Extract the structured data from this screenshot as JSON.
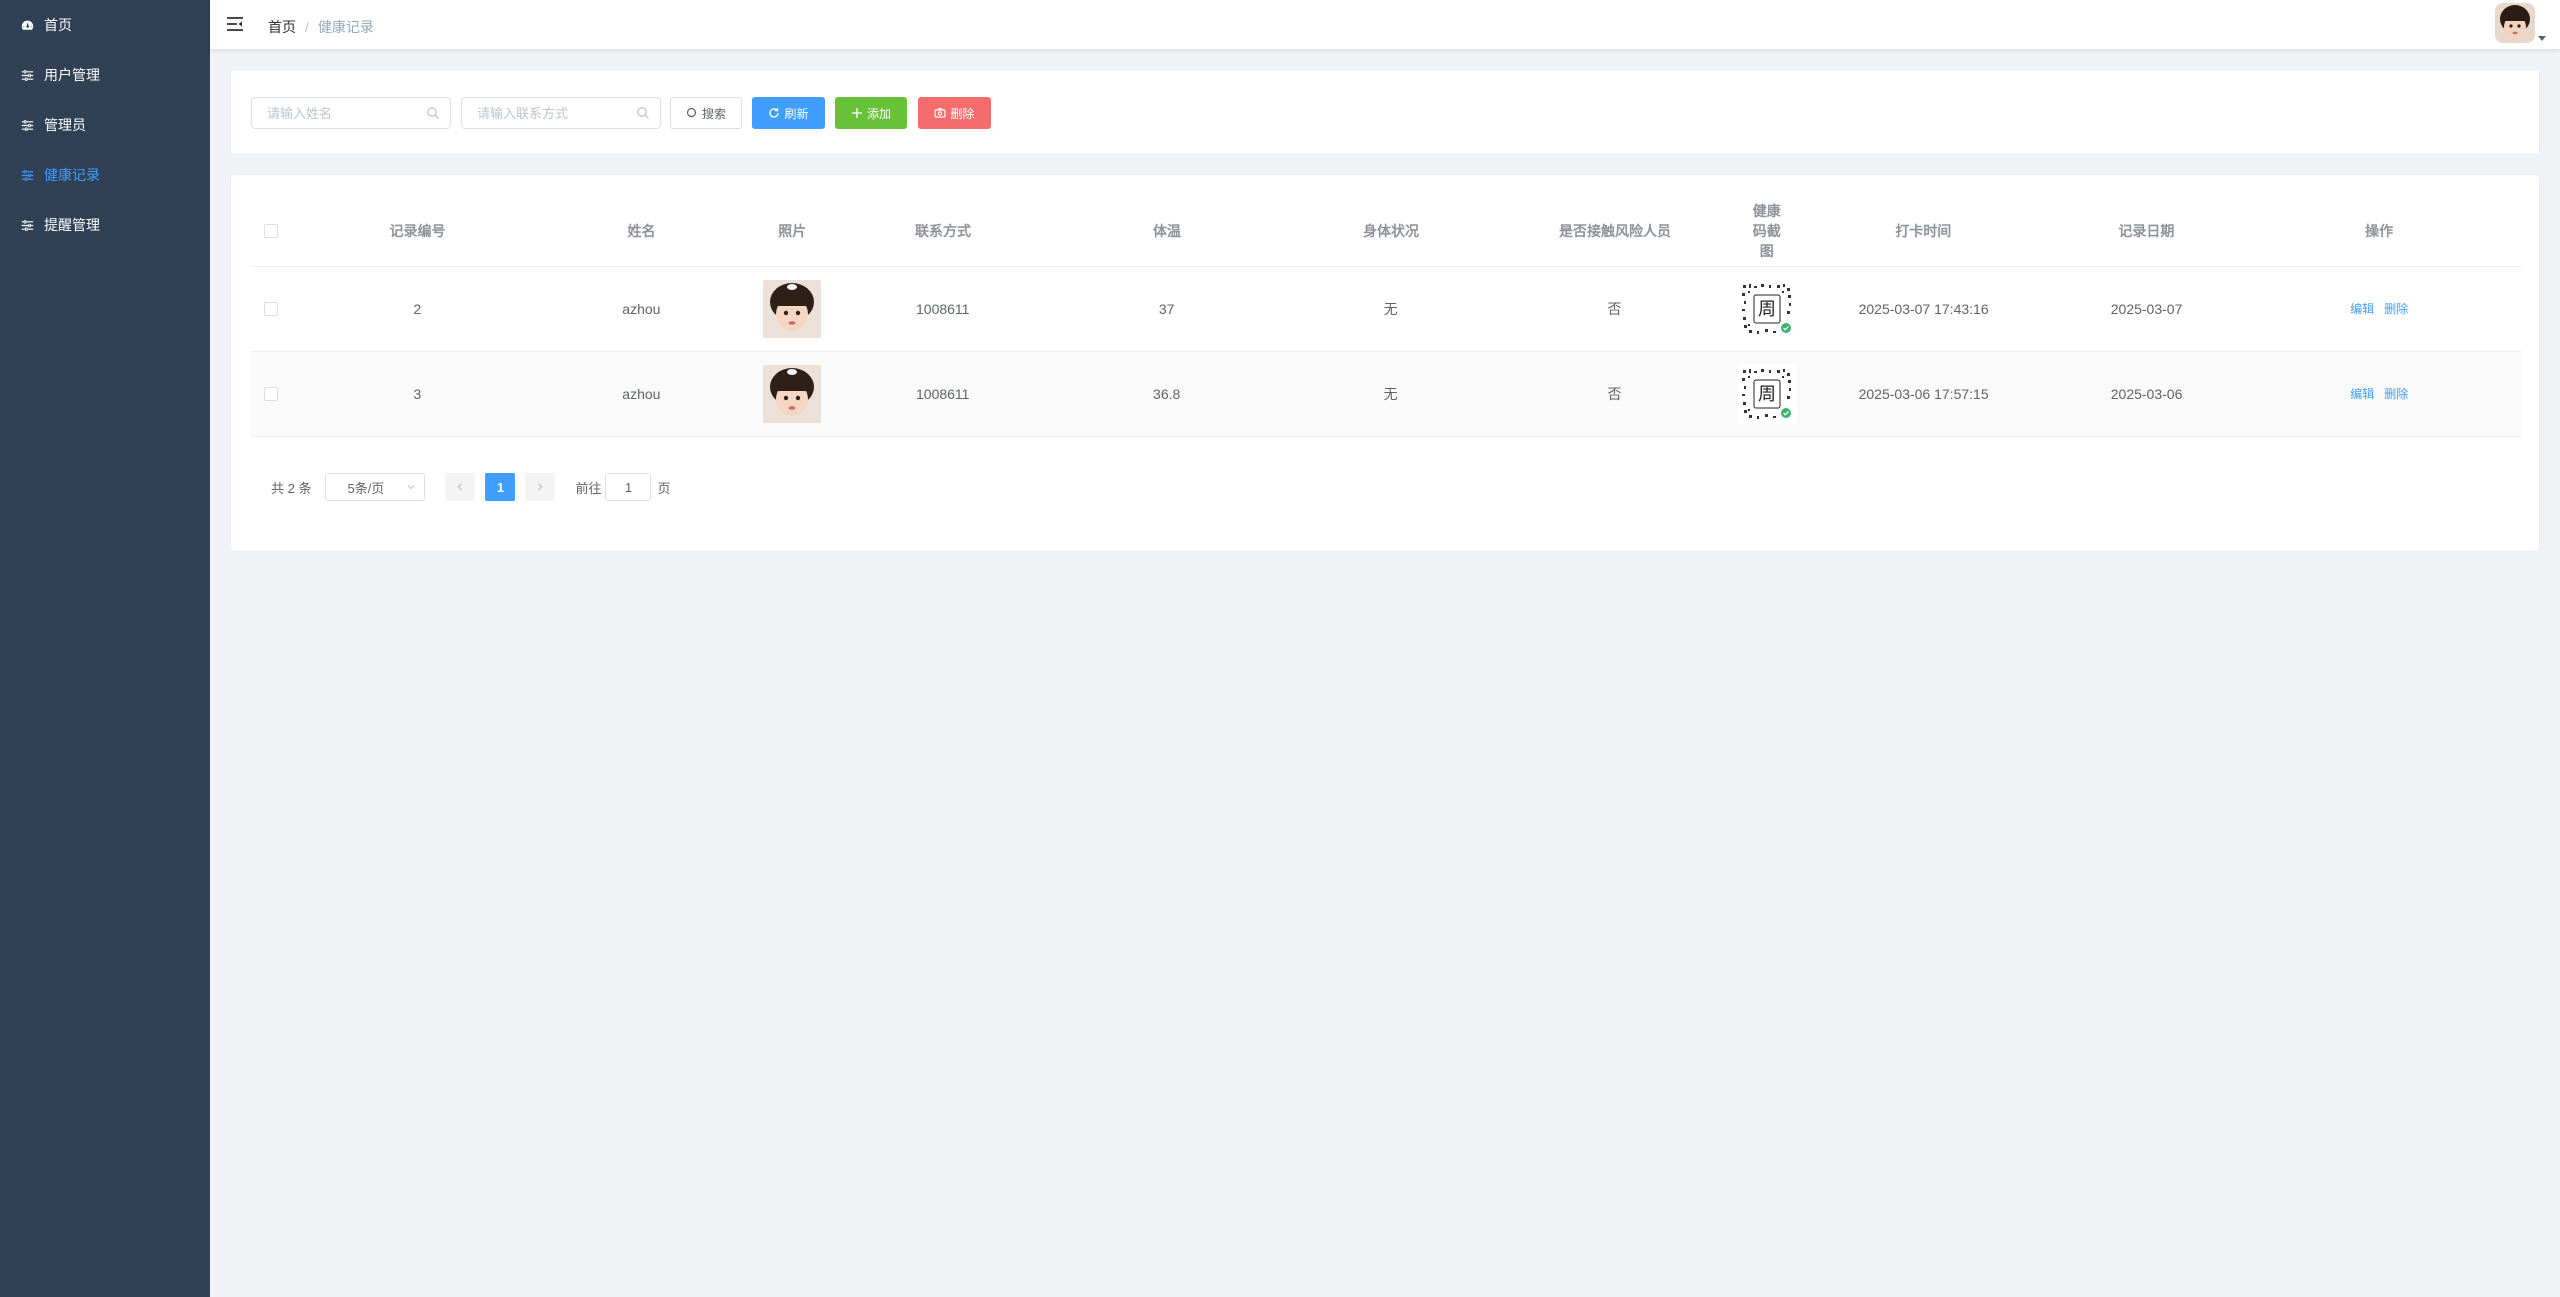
{
  "sidebar": {
    "items": [
      {
        "label": "首页",
        "icon": "dashboard-icon"
      },
      {
        "label": "用户管理",
        "icon": "sliders-icon"
      },
      {
        "label": "管理员",
        "icon": "sliders-icon"
      },
      {
        "label": "健康记录",
        "icon": "sliders-icon",
        "active": true
      },
      {
        "label": "提醒管理",
        "icon": "sliders-icon"
      }
    ]
  },
  "header": {
    "breadcrumb": {
      "home": "首页",
      "separator": "/",
      "current": "健康记录"
    }
  },
  "search": {
    "name_placeholder": "请输入姓名",
    "phone_placeholder": "请输入联系方式",
    "search_label": "搜索",
    "refresh_label": "刷新",
    "add_label": "添加",
    "delete_label": "删除"
  },
  "table": {
    "columns": {
      "id": "记录编号",
      "name": "姓名",
      "photo": "照片",
      "phone": "联系方式",
      "temp": "体温",
      "condition": "身体状况",
      "risk": "是否接触风险人员",
      "code": "健康码截图",
      "time": "打卡时间",
      "date": "记录日期",
      "ops": "操作"
    },
    "rows": [
      {
        "id": "2",
        "name": "azhou",
        "phone": "1008611",
        "temp": "37",
        "condition": "无",
        "risk": "否",
        "time": "2025-03-07 17:43:16",
        "date": "2025-03-07",
        "edit": "编辑",
        "delete": "删除"
      },
      {
        "id": "3",
        "name": "azhou",
        "phone": "1008611",
        "temp": "36.8",
        "condition": "无",
        "risk": "否",
        "time": "2025-03-06 17:57:15",
        "date": "2025-03-06",
        "edit": "编辑",
        "delete": "删除"
      }
    ]
  },
  "pagination": {
    "total": "共 2 条",
    "page_size": "5条/页",
    "current_page": "1",
    "goto_prefix": "前往",
    "goto_value": "1",
    "goto_suffix": "页"
  },
  "colors": {
    "sidebar_bg": "#304156",
    "primary": "#409eff",
    "success": "#67c23a",
    "danger": "#f56c6c"
  }
}
